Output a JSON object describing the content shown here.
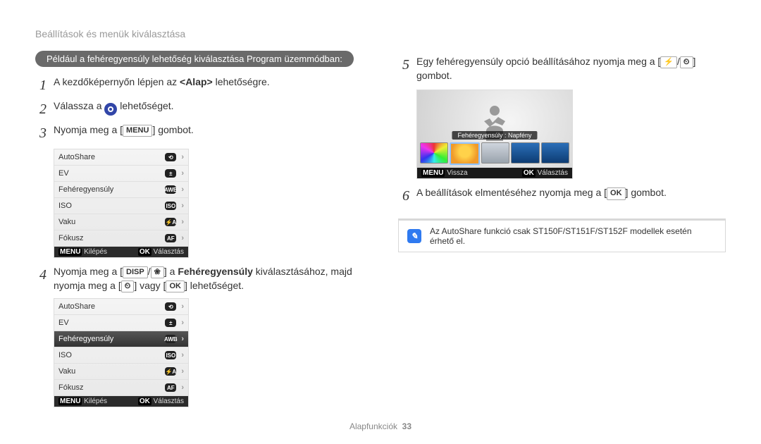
{
  "breadcrumb": "Beállítások és menük kiválasztása",
  "example_header": "Például a fehéregyensúly lehetőség kiválasztása Program üzemmódban:",
  "steps": {
    "s1": {
      "num": "1",
      "text_a": "A kezdőképernyőn lépjen az ",
      "alap": "<Alap>",
      "text_b": " lehetőségre."
    },
    "s2": {
      "num": "2",
      "text_a": "Válassza a ",
      "text_b": " lehetőséget."
    },
    "s3": {
      "num": "3",
      "text_a": "Nyomja meg a [",
      "key": "MENU",
      "text_b": "] gombot."
    },
    "s4": {
      "num": "4",
      "text_a": "Nyomja meg a [",
      "k1": "DISP",
      "slash": "/",
      "k2": "❀",
      "text_mid": "] a ",
      "bold": "Fehéregyensúly",
      "text_b": " kiválasztásához, majd nyomja meg a [",
      "k3": "⏲",
      "text_c": "] vagy [",
      "k4": "OK",
      "text_d": "] lehetőséget."
    },
    "s5": {
      "num": "5",
      "text_a": "Egy fehéregyensúly opció beállításához nyomja meg a [",
      "k1": "⚡",
      "slash": "/",
      "k2": "⏲",
      "text_b": "] gombot."
    },
    "s6": {
      "num": "6",
      "text_a": "A beállítások elmentéséhez nyomja meg a [",
      "k1": "OK",
      "text_b": "] gombot."
    }
  },
  "menu": {
    "items": [
      {
        "label": "AutoShare",
        "badge": "⟲"
      },
      {
        "label": "EV",
        "badge": "±"
      },
      {
        "label": "Fehéregyensúly",
        "badge": "AWB"
      },
      {
        "label": "ISO",
        "badge": "ISO"
      },
      {
        "label": "Vaku",
        "badge": "⚡A"
      },
      {
        "label": "Fókusz",
        "badge": "AF"
      }
    ],
    "footer_left_key": "MENU",
    "footer_left": "Kilépés",
    "footer_right_key": "OK",
    "footer_right": "Választás"
  },
  "preview": {
    "wb_label": "Fehéregyensúly : Napfény",
    "swatches": [
      "auto",
      "sun",
      "cloud",
      "flu1",
      "flu2"
    ],
    "footer_left_key": "MENU",
    "footer_left": "Vissza",
    "footer_right_key": "OK",
    "footer_right": "Választás"
  },
  "note": "Az AutoShare funkció csak ST150F/ST151F/ST152F modellek esetén érhető el.",
  "footer_section": "Alapfunkciók",
  "footer_page": "33"
}
